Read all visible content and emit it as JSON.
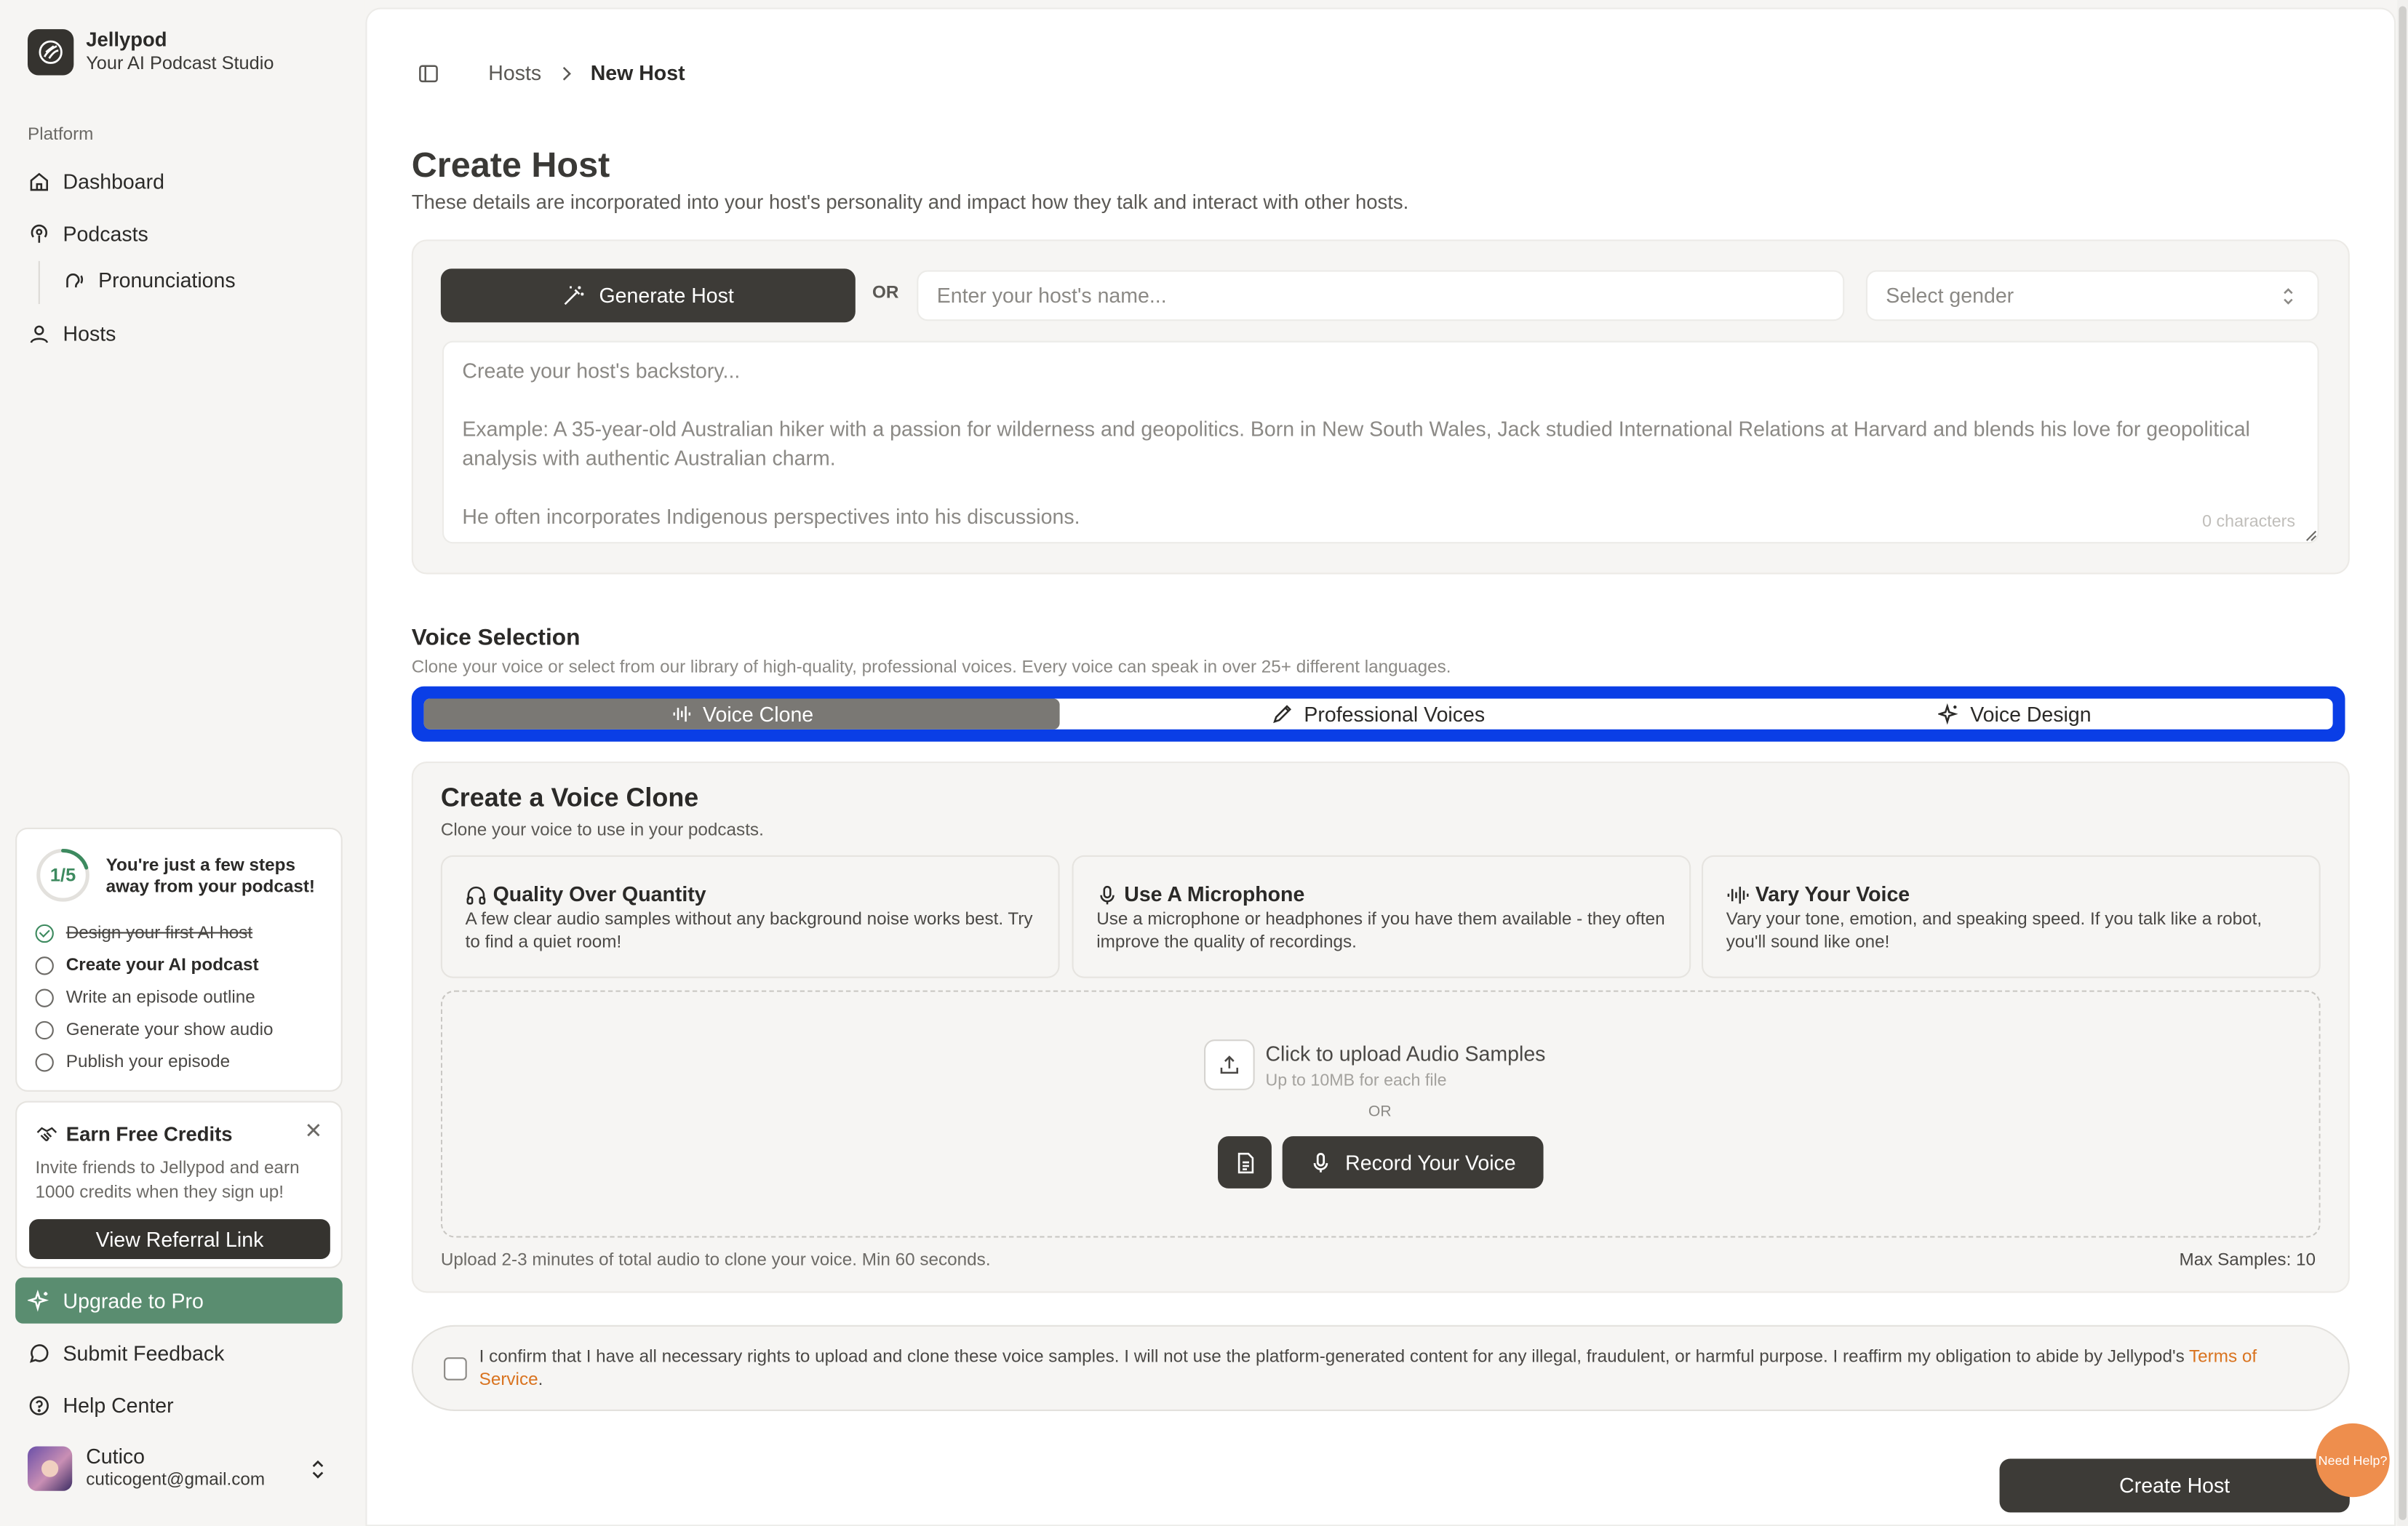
{
  "brand": {
    "name": "Jellypod",
    "tagline": "Your AI Podcast Studio"
  },
  "sidebar": {
    "section_label": "Platform",
    "items": [
      {
        "label": "Dashboard",
        "icon": "home-icon"
      },
      {
        "label": "Podcasts",
        "icon": "podcast-icon"
      },
      {
        "label": "Pronunciations",
        "icon": "voice-icon"
      },
      {
        "label": "Hosts",
        "icon": "user-icon"
      }
    ],
    "steps_card": {
      "progress": "1/5",
      "progress_fraction": 0.2,
      "title": "You're just a few steps away from your podcast!",
      "steps": [
        {
          "label": "Design your first AI host",
          "state": "done"
        },
        {
          "label": "Create your AI podcast",
          "state": "active"
        },
        {
          "label": "Write an episode outline",
          "state": "todo"
        },
        {
          "label": "Generate your show audio",
          "state": "todo"
        },
        {
          "label": "Publish your episode",
          "state": "todo"
        }
      ]
    },
    "credits_card": {
      "title": "Earn Free Credits",
      "text": "Invite friends to Jellypod and earn 1000 credits when they sign up!",
      "button": "View Referral Link"
    },
    "upgrade": "Upgrade to Pro",
    "feedback": "Submit Feedback",
    "help": "Help Center",
    "user": {
      "name": "Cutico",
      "email": "cuticogent@gmail.com"
    }
  },
  "breadcrumb": {
    "parent": "Hosts",
    "current": "New Host"
  },
  "page": {
    "title": "Create Host",
    "description": "These details are incorporated into your host's personality and impact how they talk and interact with other hosts."
  },
  "host_form": {
    "generate_button": "Generate Host",
    "or": "OR",
    "name_placeholder": "Enter your host's name...",
    "gender_placeholder": "Select gender",
    "backstory_lines": [
      "Create your host's backstory...",
      "Example: A 35-year-old Australian hiker with a passion for wilderness and geopolitics. Born in New South Wales, Jack studied International Relations at Harvard and blends his love for geopolitical analysis with authentic Australian charm.",
      "He often incorporates Indigenous perspectives into his discussions."
    ],
    "char_count": "0 characters"
  },
  "voice_selection": {
    "title": "Voice Selection",
    "description": "Clone your voice or select from our library of high-quality, professional voices. Every voice can speak in over 25+ different languages.",
    "tabs": [
      {
        "label": "Voice Clone",
        "active": true
      },
      {
        "label": "Professional Voices",
        "active": false
      },
      {
        "label": "Voice Design",
        "active": false
      }
    ]
  },
  "voice_clone": {
    "title": "Create a Voice Clone",
    "description": "Clone your voice to use in your podcasts.",
    "tips": [
      {
        "title": "Quality Over Quantity",
        "icon": "headphones-icon",
        "body": "A few clear audio samples without any background noise works best. Try to find a quiet room!"
      },
      {
        "title": "Use A Microphone",
        "icon": "microphone-icon",
        "body": "Use a microphone or headphones if you have them available - they often improve the quality of recordings."
      },
      {
        "title": "Vary Your Voice",
        "icon": "waveform-icon",
        "body": "Vary your tone, emotion, and speaking speed. If you talk like a robot, you'll sound like one!"
      }
    ],
    "upload_title": "Click to upload Audio Samples",
    "upload_sub": "Up to 10MB for each file",
    "or": "OR",
    "record_button": "Record Your Voice",
    "note": "Upload 2-3 minutes of total audio to clone your voice. Min 60 seconds.",
    "max_samples": "Max Samples: 10"
  },
  "consent": {
    "text": "I confirm that I have all necessary rights to upload and clone these voice samples. I will not use the platform-generated content for any illegal, fraudulent, or harmful purpose. I reaffirm my obligation to abide by Jellypod's ",
    "link": "Terms of Service",
    "end": "."
  },
  "create_button": "Create Host",
  "help_bubble": "Need Help?",
  "colors": {
    "accent": "#0a3ee6",
    "upgrade": "#5a8d70",
    "link": "#d9731f",
    "help": "#ee8e4d"
  }
}
